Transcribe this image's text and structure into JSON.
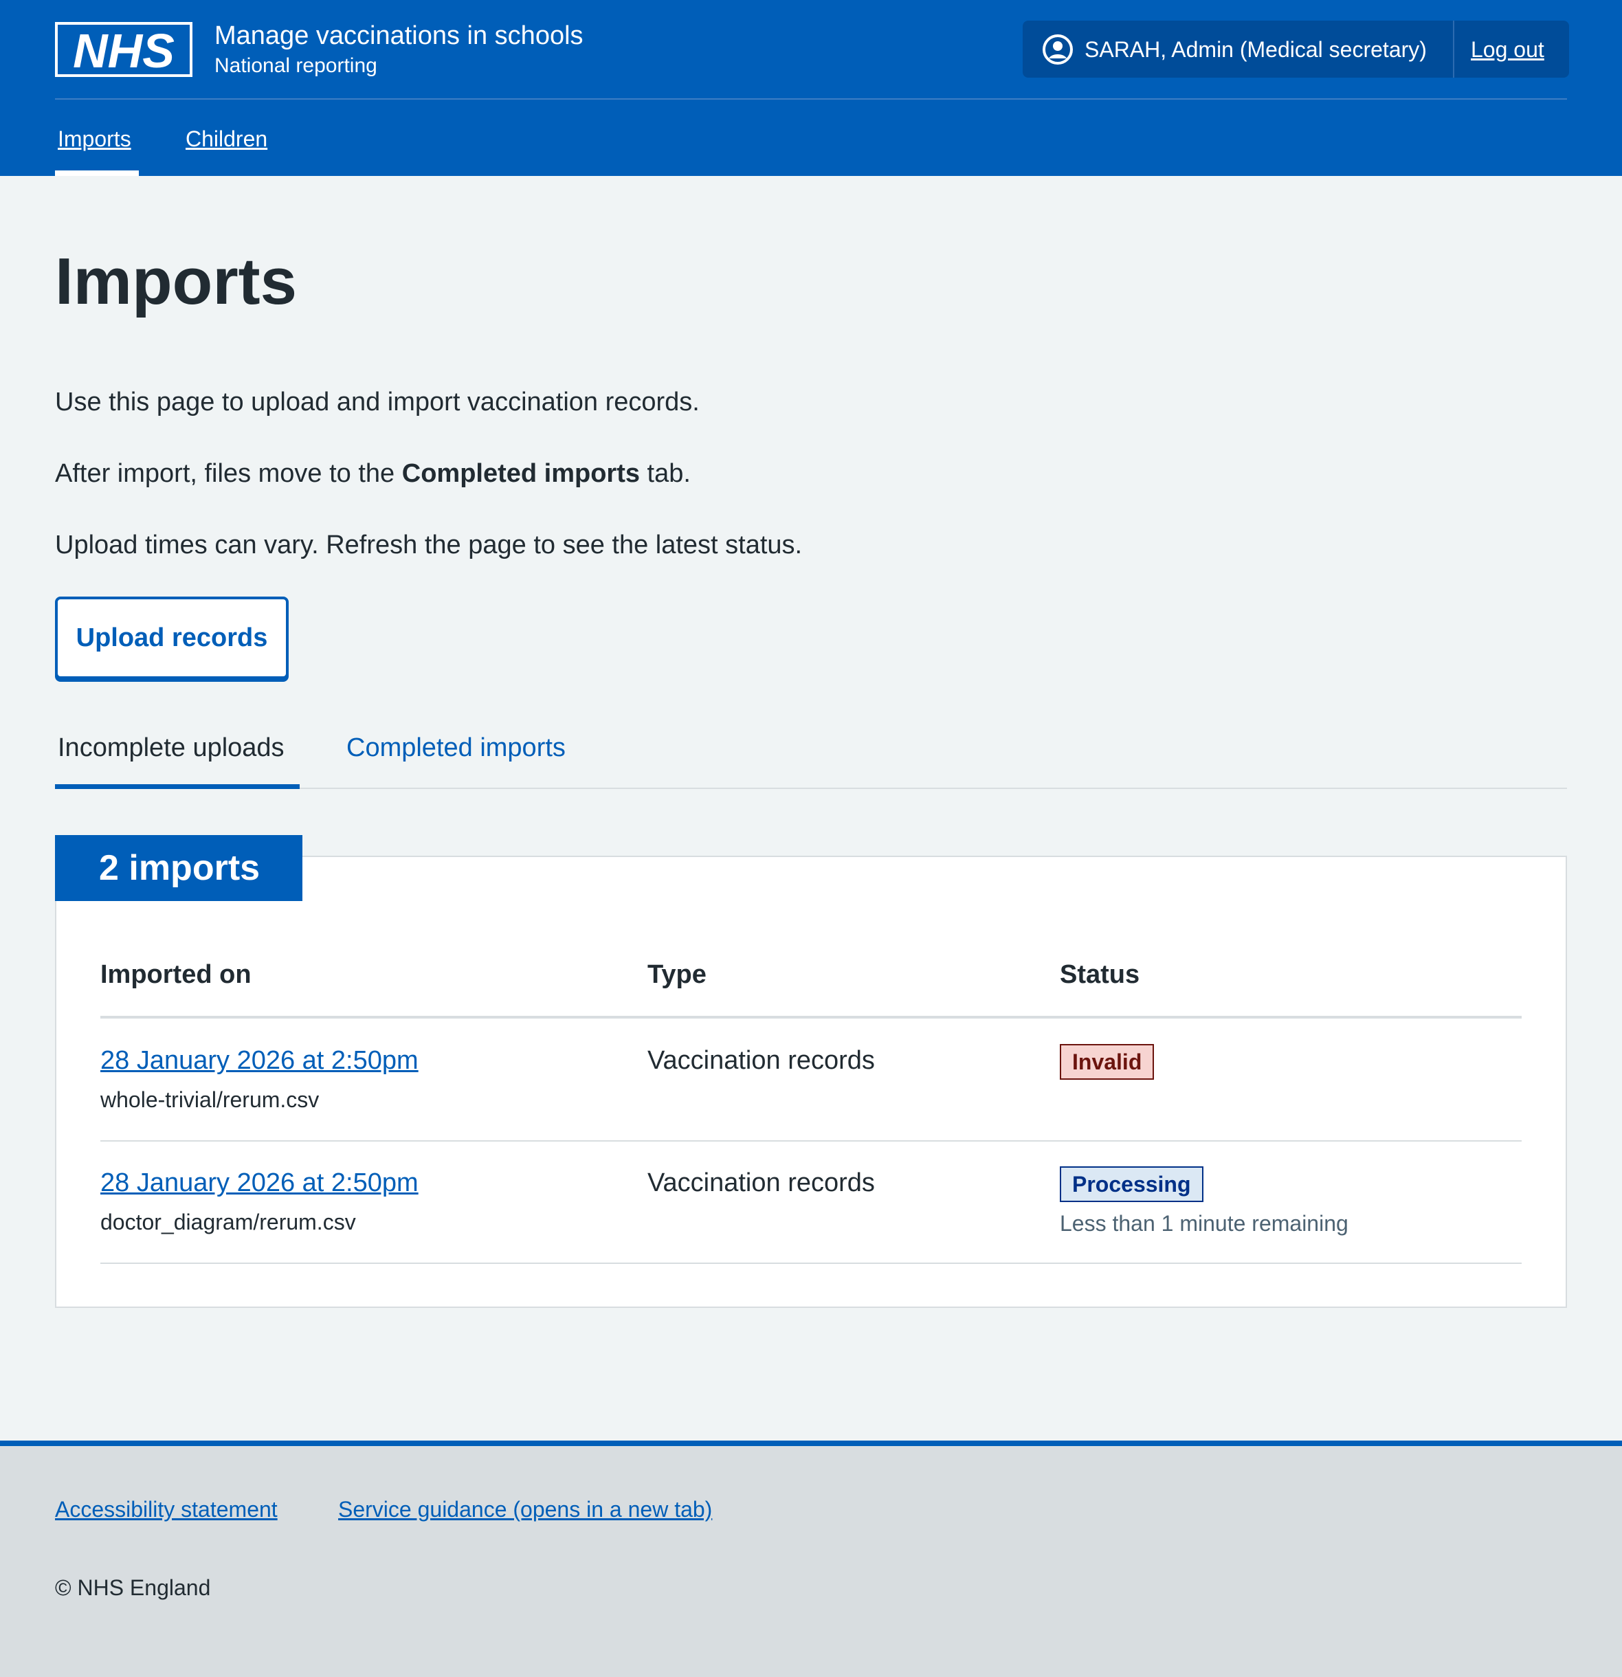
{
  "header": {
    "logo_text": "NHS",
    "service_name": "Manage vaccinations in schools",
    "service_subtitle": "National reporting",
    "account_name": "SARAH, Admin (Medical secretary)",
    "logout_label": "Log out",
    "account_icon": "user-circle-icon",
    "nav": [
      {
        "label": "Imports",
        "active": true
      },
      {
        "label": "Children",
        "active": false
      }
    ]
  },
  "main": {
    "title": "Imports",
    "intro_1": "Use this page to upload and import vaccination records.",
    "intro_2_before": "After import, files move to the ",
    "intro_2_bold": "Completed imports",
    "intro_2_after": " tab.",
    "intro_3": "Upload times can vary. Refresh the page to see the latest status.",
    "upload_button": "Upload records",
    "tabs": [
      {
        "label": "Incomplete uploads",
        "active": true
      },
      {
        "label": "Completed imports",
        "active": false
      }
    ],
    "card_heading": "2 imports",
    "table": {
      "columns": [
        "Imported on",
        "Type",
        "Status"
      ],
      "rows": [
        {
          "imported_on": "28 January 2026 at 2:50pm",
          "file": "whole-trivial/rerum.csv",
          "type": "Vaccination records",
          "status": "Invalid",
          "status_hint": ""
        },
        {
          "imported_on": "28 January 2026 at 2:50pm",
          "file": "doctor_diagram/rerum.csv",
          "type": "Vaccination records",
          "status": "Processing",
          "status_hint": "Less than 1 minute remaining"
        }
      ]
    }
  },
  "footer": {
    "links": [
      "Accessibility statement",
      "Service guidance (opens in a new tab)"
    ],
    "copyright": "© NHS England"
  },
  "colors": {
    "brand_blue": "#005eb8",
    "page_background": "#f0f4f5",
    "invalid_tag_bg": "#f7d4d1",
    "invalid_tag_text": "#6b140e",
    "processing_tag_bg": "#dbe8f4",
    "processing_tag_text": "#003087"
  }
}
